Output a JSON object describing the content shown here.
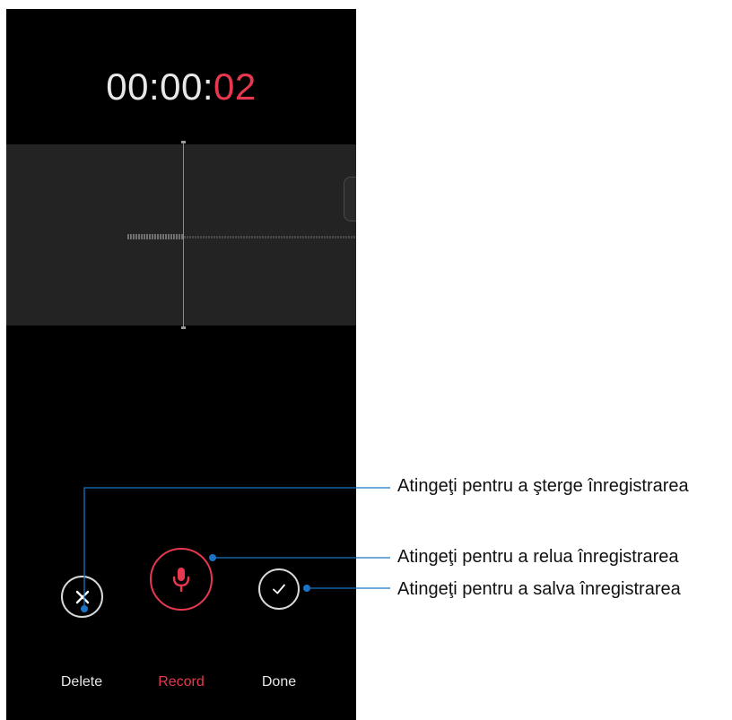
{
  "timer": {
    "prefix": "00:00:",
    "seconds": "02"
  },
  "controls": {
    "delete": {
      "label": "Delete",
      "icon": "close-icon"
    },
    "record": {
      "label": "Record",
      "icon": "microphone-icon"
    },
    "done": {
      "label": "Done",
      "icon": "checkmark-icon"
    }
  },
  "callouts": {
    "delete": "Atingeţi pentru a şterge înregistrarea",
    "record": "Atingeţi pentru a relua înregistrarea",
    "done": "Atingeţi pentru a salva înregistrarea"
  },
  "colors": {
    "accent": "#e8384f",
    "callout_line": "#1a73c4",
    "panel": "#232323",
    "background": "#000000"
  }
}
